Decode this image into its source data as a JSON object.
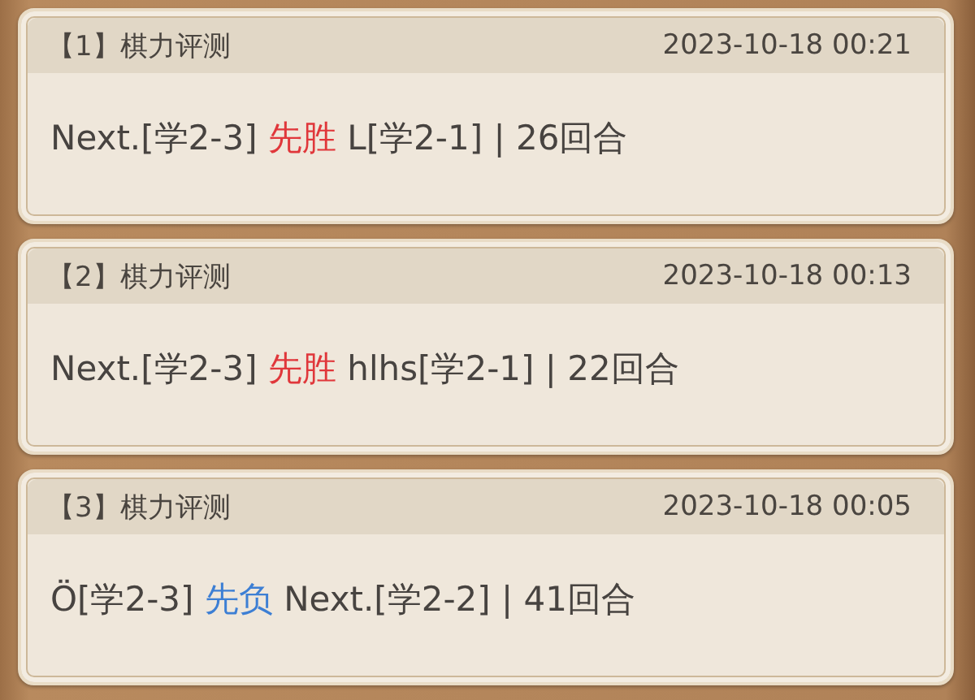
{
  "records": [
    {
      "title": "【1】棋力评测",
      "time": "2023-10-18 00:21",
      "player": "Next.[学2-3]",
      "outcome": {
        "text": "先胜",
        "kind": "win"
      },
      "rest": "L[学2-1] | 26回合"
    },
    {
      "title": "【2】棋力评测",
      "time": "2023-10-18 00:13",
      "player": "Next.[学2-3]",
      "outcome": {
        "text": "先胜",
        "kind": "win"
      },
      "rest": "hlhs[学2-1] | 22回合"
    },
    {
      "title": "【3】棋力评测",
      "time": "2023-10-18 00:05",
      "player": "Ö[学2-3]",
      "outcome": {
        "text": "先负",
        "kind": "loss"
      },
      "rest": "Next.[学2-2] | 41回合"
    }
  ]
}
